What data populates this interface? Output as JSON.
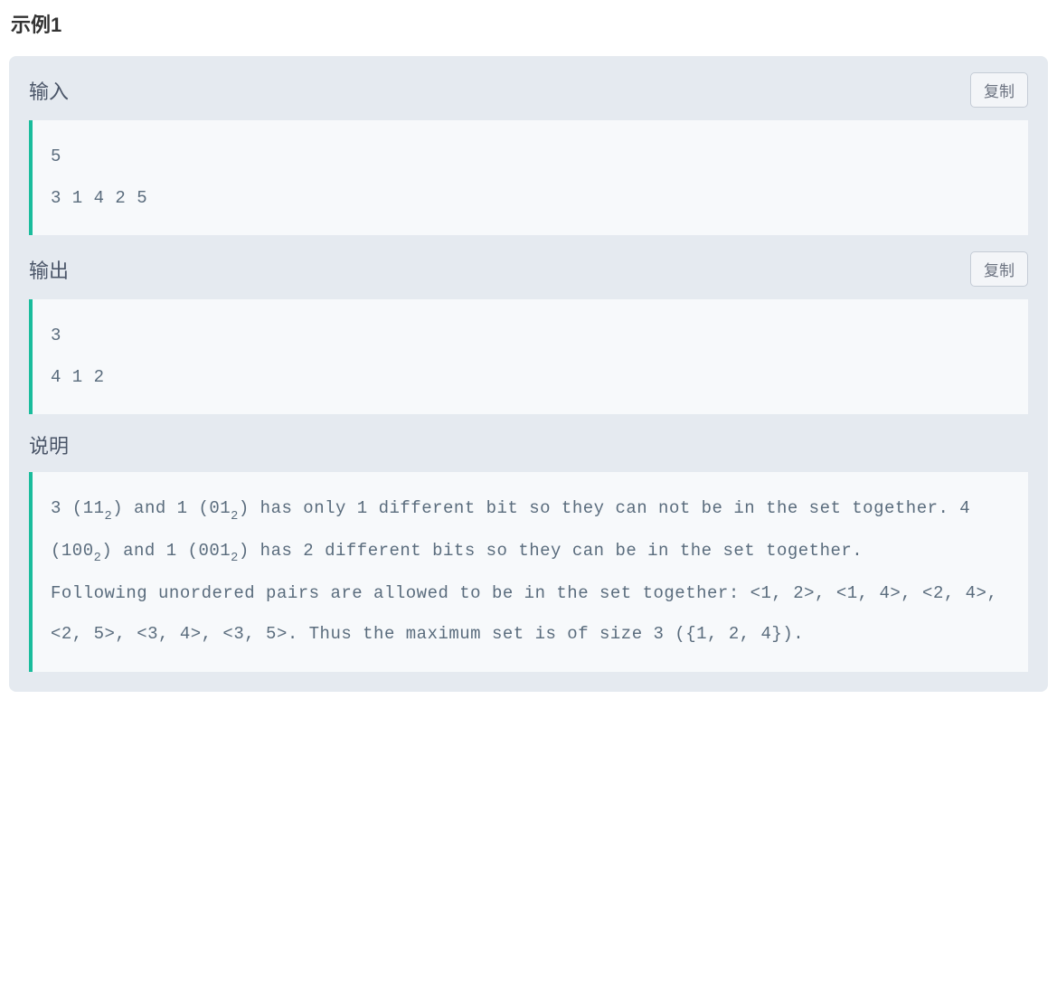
{
  "example": {
    "title": "示例1",
    "input": {
      "label": "输入",
      "copy_label": "复制",
      "content": "5\n3 1 4 2 5"
    },
    "output": {
      "label": "输出",
      "copy_label": "复制",
      "content": "3\n4 1 2"
    },
    "explanation": {
      "label": "说明",
      "paragraphs": [
        {
          "segments": [
            {
              "t": "text",
              "v": "3 (11"
            },
            {
              "t": "sub",
              "v": "2"
            },
            {
              "t": "text",
              "v": ") and 1 (01"
            },
            {
              "t": "sub",
              "v": "2"
            },
            {
              "t": "text",
              "v": ") has only 1 different bit so they can not be in the set together. 4 (100"
            },
            {
              "t": "sub",
              "v": "2"
            },
            {
              "t": "text",
              "v": ") and 1 (001"
            },
            {
              "t": "sub",
              "v": "2"
            },
            {
              "t": "text",
              "v": ") has 2 different bits so they can be in the set together."
            }
          ]
        },
        {
          "segments": [
            {
              "t": "text",
              "v": "Following unordered pairs are allowed to be in the set together: <1, 2>, <1, 4>, <2, 4>, <2, 5>, <3, 4>, <3, 5>. Thus the maximum set is of size 3 ({1, 2, 4})."
            }
          ]
        }
      ]
    }
  }
}
